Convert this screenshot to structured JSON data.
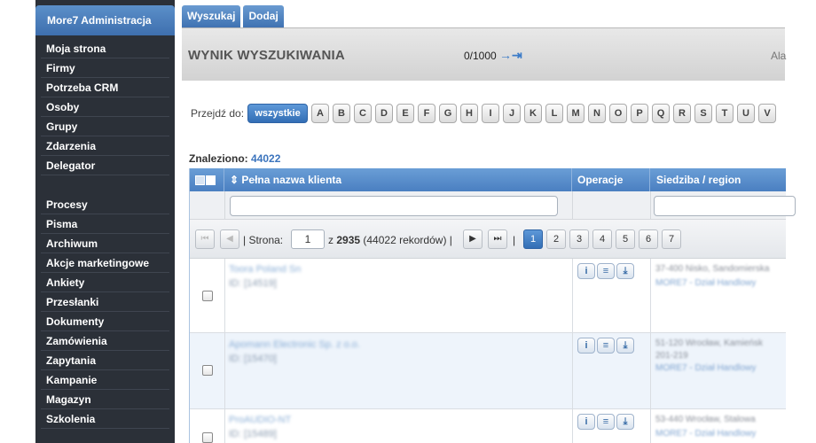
{
  "sidebar": {
    "title": "More7 Administracja",
    "group1": [
      "Moja strona",
      "Firmy",
      "Potrzeba CRM",
      "Osoby",
      "Grupy",
      "Zdarzenia",
      "Delegator"
    ],
    "group2": [
      "Procesy",
      "Pisma",
      "Archiwum",
      "Akcje marketingowe",
      "Ankiety",
      "Przesłanki",
      "Dokumenty",
      "Zamówienia",
      "Zapytania",
      "Kampanie",
      "Magazyn",
      "Szkolenia"
    ]
  },
  "tabs": [
    "Wyszukaj",
    "Dodaj"
  ],
  "header": {
    "title": "WYNIK WYSZUKIWANIA",
    "count": "0/1000",
    "arrow": "→⇥",
    "right_text": "Ala"
  },
  "alphabet": {
    "label": "Przejdź do:",
    "all": "wszystkie",
    "letters": [
      "A",
      "B",
      "C",
      "D",
      "E",
      "F",
      "G",
      "H",
      "I",
      "J",
      "K",
      "L",
      "M",
      "N",
      "O",
      "P",
      "Q",
      "R",
      "S",
      "T",
      "U",
      "V"
    ]
  },
  "found": {
    "label": "Znaleziono:",
    "count": "44022"
  },
  "grid": {
    "columns": {
      "name": "Pełna nazwa klienta",
      "ops": "Operacje",
      "seat": "Siedziba / region"
    },
    "pager": {
      "page_label": "Strona:",
      "page_value": "1",
      "of_text": "z",
      "total_pages": "2935",
      "records": "(44022 rekordów)",
      "pages": [
        "1",
        "2",
        "3",
        "4",
        "5",
        "6",
        "7"
      ]
    },
    "rows": [
      {
        "name": "Toora Poland Sn",
        "id": "ID: [14519]",
        "seat1": "37-400 Nisko, Sandomierska",
        "seat2": "MORE7 - Dział Handlowy"
      },
      {
        "name": "Apomann Electronic Sp. z o.o.",
        "id": "ID: [15470]",
        "seat1": "51-120 Wrocław, Kamieńsk",
        "seat_extra": "201-219",
        "seat2": "MORE7 - Dział Handlowy"
      },
      {
        "name": "ProAUDIO-NT",
        "id": "ID: [15489]",
        "seat1": "53-440 Wrocław, Stalowa",
        "seat2": "MORE7 - Dział Handlowy"
      }
    ]
  },
  "colors": {
    "accent": "#3f72b2",
    "sidebar_bg": "#2b3038",
    "link": "#3b74bd"
  }
}
